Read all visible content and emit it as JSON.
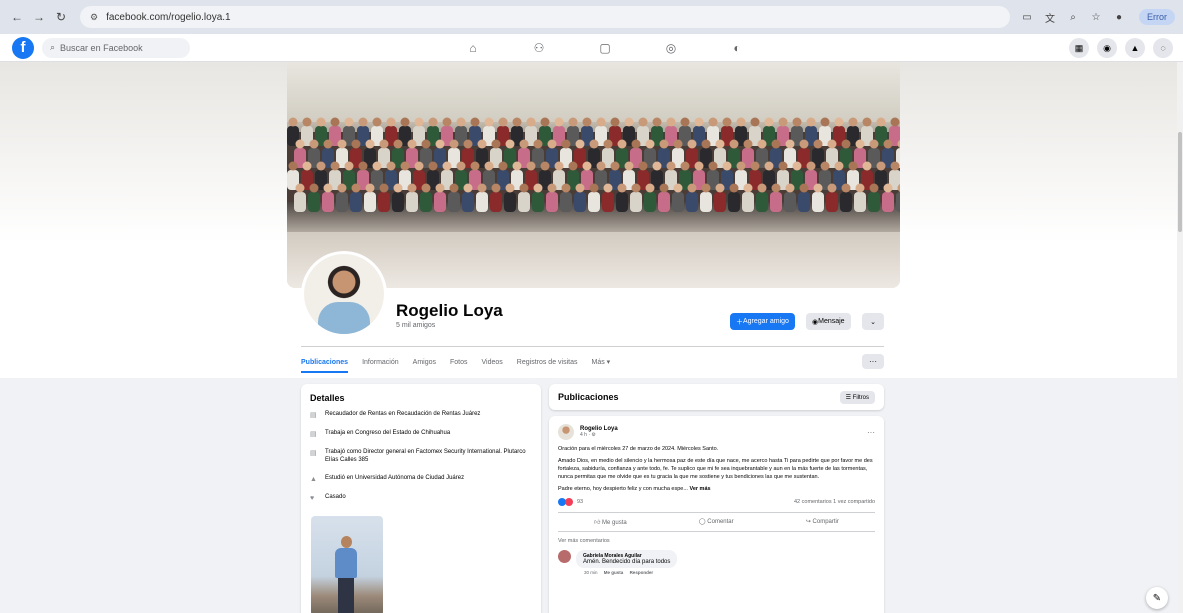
{
  "browser": {
    "url": "facebook.com/rogelio.loya.1",
    "error_label": "Error"
  },
  "fb": {
    "search_placeholder": "Buscar en Facebook"
  },
  "profile": {
    "name": "Rogelio Loya",
    "friends": "5 mil amigos",
    "add_friend": "Agregar amigo",
    "message": "Mensaje"
  },
  "tabs": [
    "Publicaciones",
    "Información",
    "Amigos",
    "Fotos",
    "Videos",
    "Registros de visitas",
    "Más ▾"
  ],
  "details": {
    "title": "Detalles",
    "items": [
      "Recaudador de Rentas en Recaudación de Rentas Juárez",
      "Trabaja en Congreso del Estado de Chihuahua",
      "Trabajó como Director general en Factomex Security International. Plutarco Elías Calles 385",
      "Estudió en Universidad Autónoma de Ciudad Juárez",
      "Casado"
    ]
  },
  "posts": {
    "title": "Publicaciones",
    "filter": "Filtros"
  },
  "post": {
    "author": "Rogelio Loya",
    "meta": "4 h · ⚙",
    "paragraphs": [
      "Oración para el miércoles 27 de marzo de 2024.  Miércoles Santo.",
      "Amado Dios, en medio del silencio y la hermosa paz de este día que nace, me acerco hasta Ti para pedirte que por favor me des fortaleza, sabiduría, confianza y ante todo, fe. Te suplico que mi fe sea inquebrantable y aun en la más fuerte de las tormentas,  nunca permitas que me olvide que es tu gracia la que me sostiene y tus bendiciones las que me sustentan.",
      "Padre eterno, hoy despierto feliz y con mucha espe..."
    ],
    "see_more": "Ver más",
    "reaction_count": "93",
    "stats": "42 comentarios   1 vez compartido",
    "like": "Me gusta",
    "comment": "Comentar",
    "share": "Compartir",
    "more_comments": "Ver más comentarios",
    "commenter": "Gabriela Morales Aguilar",
    "comment_text": "Amén. Bendecido día para todos",
    "comment_time": "30 min",
    "comment_like": "Me gusta",
    "comment_reply": "Responder"
  }
}
